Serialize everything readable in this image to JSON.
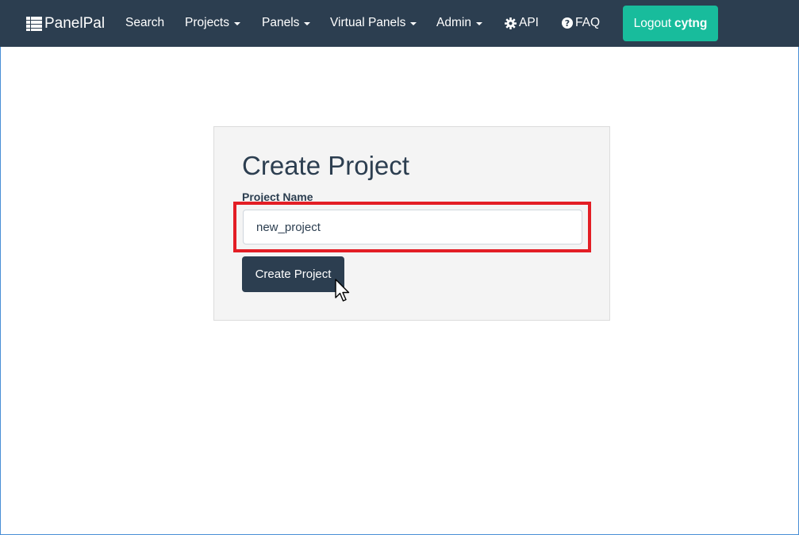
{
  "navbar": {
    "brand": "PanelPal",
    "brand_icon": "table-list-icon",
    "search": "Search",
    "projects": "Projects",
    "panels": "Panels",
    "virtual_panels": "Virtual Panels",
    "admin": "Admin",
    "api": "API",
    "api_icon": "gear-icon",
    "faq": "FAQ",
    "faq_icon": "question-circle-icon",
    "logout_label": "Logout",
    "logout_user": "cytng"
  },
  "form": {
    "title": "Create Project",
    "name_label": "Project Name",
    "name_value": "new_project",
    "submit_label": "Create Project"
  },
  "colors": {
    "navbar_bg": "#2c3e50",
    "logout_bg": "#18bc9c",
    "highlight": "#e31e25",
    "primary_button": "#2c3e50"
  }
}
